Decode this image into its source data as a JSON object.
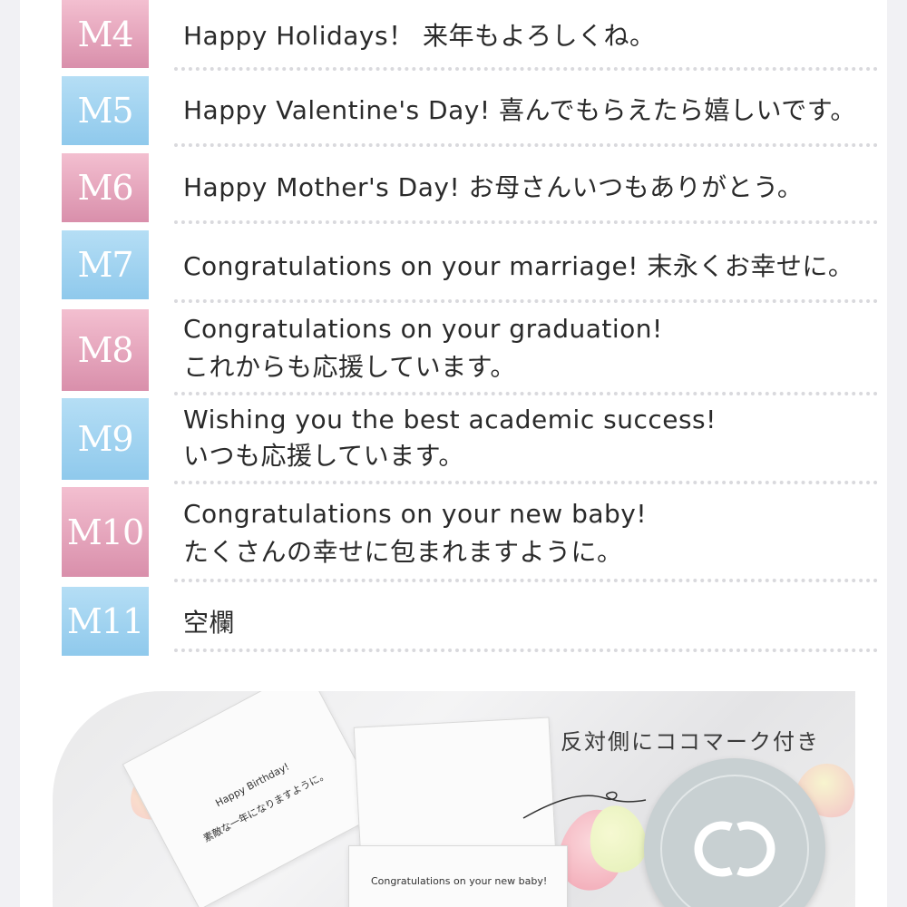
{
  "rows": [
    {
      "code": "M4",
      "color": "pink",
      "lines": [
        "Happy Holidays！ 来年もよろしくね。"
      ]
    },
    {
      "code": "M5",
      "color": "blue",
      "lines": [
        "Happy Valentine's Day! 喜んでもらえたら嬉しいです。"
      ]
    },
    {
      "code": "M6",
      "color": "pink",
      "lines": [
        "Happy Mother's Day! お母さんいつもありがとう。"
      ]
    },
    {
      "code": "M7",
      "color": "blue",
      "lines": [
        "Congratulations on your marriage! 末永くお幸せに。"
      ]
    },
    {
      "code": "M8",
      "color": "pink",
      "lines": [
        "Congratulations on your graduation!",
        "これからも応援しています。"
      ]
    },
    {
      "code": "M9",
      "color": "blue",
      "lines": [
        "Wishing you the best academic success!",
        "いつも応援しています。"
      ]
    },
    {
      "code": "M10",
      "color": "pink",
      "lines": [
        "Congratulations on your new baby!",
        "たくさんの幸せに包まれますように。"
      ]
    },
    {
      "code": "M11",
      "color": "blue",
      "lines": [
        "空欄"
      ]
    }
  ],
  "photo": {
    "caption": "反対側にココマーク付き",
    "card1_line1": "Happy Birthday!",
    "card1_line2": "素敵な一年になりますように。",
    "card3_line1": "Congratulations on your new baby!"
  },
  "colors": {
    "pink_badge": "#e2a3bb",
    "blue_badge": "#a3d4f0",
    "dots": "#d9d9dd"
  }
}
